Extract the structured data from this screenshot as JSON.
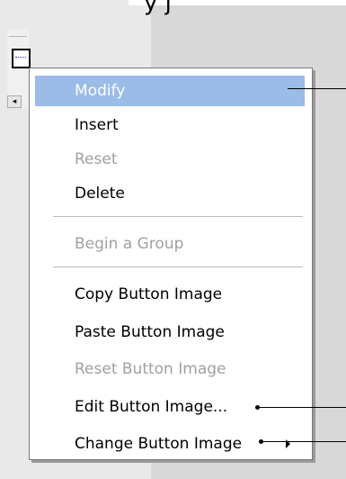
{
  "top_cutoff_text": "y      j",
  "toolbar": {
    "scroll_arrow": "◂"
  },
  "menu": {
    "items": [
      {
        "label": "Modify"
      },
      {
        "label": "Insert"
      },
      {
        "label": "Reset"
      },
      {
        "label": "Delete"
      },
      {
        "label": "Begin a Group"
      },
      {
        "label": "Copy Button Image"
      },
      {
        "label": "Paste Button Image"
      },
      {
        "label": "Reset Button Image"
      },
      {
        "label": "Edit Button Image..."
      },
      {
        "label": "Change Button Image"
      }
    ],
    "highlight_color": "#9bbbe8",
    "disabled_color": "#a0a0a0"
  }
}
